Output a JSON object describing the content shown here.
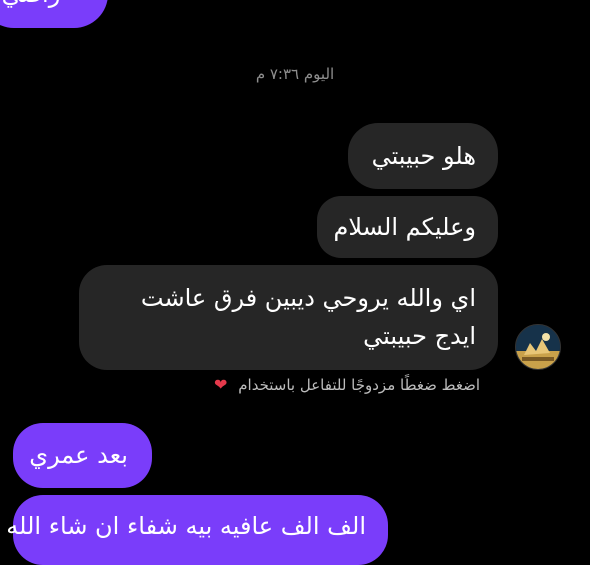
{
  "conversation": {
    "previous_outgoing_fragment": "راضي",
    "timestamp": "اليوم ٧:٣٦ م",
    "messages": [
      {
        "direction": "incoming",
        "text": "هلو حبيبتي"
      },
      {
        "direction": "incoming",
        "text": "وعليكم السلام"
      },
      {
        "direction": "incoming",
        "text": "اي والله يروحي ديبين فرق عاشت ايدج حبيبتي"
      },
      {
        "direction": "outgoing",
        "text": "بعد عمري"
      },
      {
        "direction": "outgoing",
        "text": "الف الف عافيه بيه شفاء ان شاء الله"
      }
    ],
    "reaction_hint": "اضغط ضغطًا مزدوجًا للتفاعل باستخدام",
    "reaction_icon": "heart-icon"
  },
  "colors": {
    "background": "#000000",
    "incoming_bubble": "#262626",
    "outgoing_bubble": "#7a3dfa",
    "timestamp_text": "#8e8e8e",
    "heart": "#e5394b"
  }
}
